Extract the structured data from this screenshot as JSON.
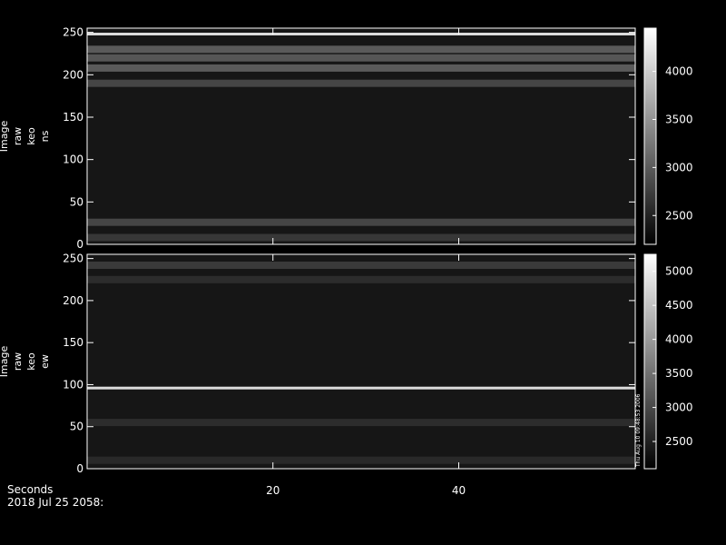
{
  "chart_data": [
    {
      "type": "heatmap",
      "ylabel_lines": [
        "Image",
        "raw",
        "keo",
        "ns"
      ],
      "xlim": [
        0,
        59
      ],
      "ylim": [
        0,
        255
      ],
      "yticks": [
        0,
        50,
        100,
        150,
        200,
        250
      ],
      "colorbar": {
        "ticks": [
          2500,
          3000,
          3500,
          4000
        ],
        "range": [
          2200,
          4450
        ]
      },
      "bands": [
        {
          "y": 248,
          "v": 0.95
        },
        {
          "y": 230,
          "v": 0.45
        },
        {
          "y": 220,
          "v": 0.42
        },
        {
          "y": 208,
          "v": 0.45
        },
        {
          "y": 190,
          "v": 0.3
        },
        {
          "y": 26,
          "v": 0.3
        },
        {
          "y": 8,
          "v": 0.2
        }
      ]
    },
    {
      "type": "heatmap",
      "ylabel_lines": [
        "Image",
        "raw",
        "keo",
        "ew"
      ],
      "xlim": [
        0,
        59
      ],
      "ylim": [
        0,
        255
      ],
      "yticks": [
        0,
        50,
        100,
        150,
        200,
        250
      ],
      "colorbar": {
        "ticks": [
          2500,
          3000,
          3500,
          4000,
          4500,
          5000
        ],
        "range": [
          2100,
          5250
        ]
      },
      "annotation": "Thu Aug 10 09:48:53 2006",
      "bands": [
        {
          "y": 242,
          "v": 0.22
        },
        {
          "y": 225,
          "v": 0.12
        },
        {
          "y": 96,
          "v": 0.95
        },
        {
          "y": 55,
          "v": 0.12
        },
        {
          "y": 10,
          "v": 0.1
        }
      ]
    }
  ],
  "xticks": [
    20,
    40
  ],
  "xaxis_label": "Seconds",
  "date_label": "2018 Jul 25 2058:"
}
